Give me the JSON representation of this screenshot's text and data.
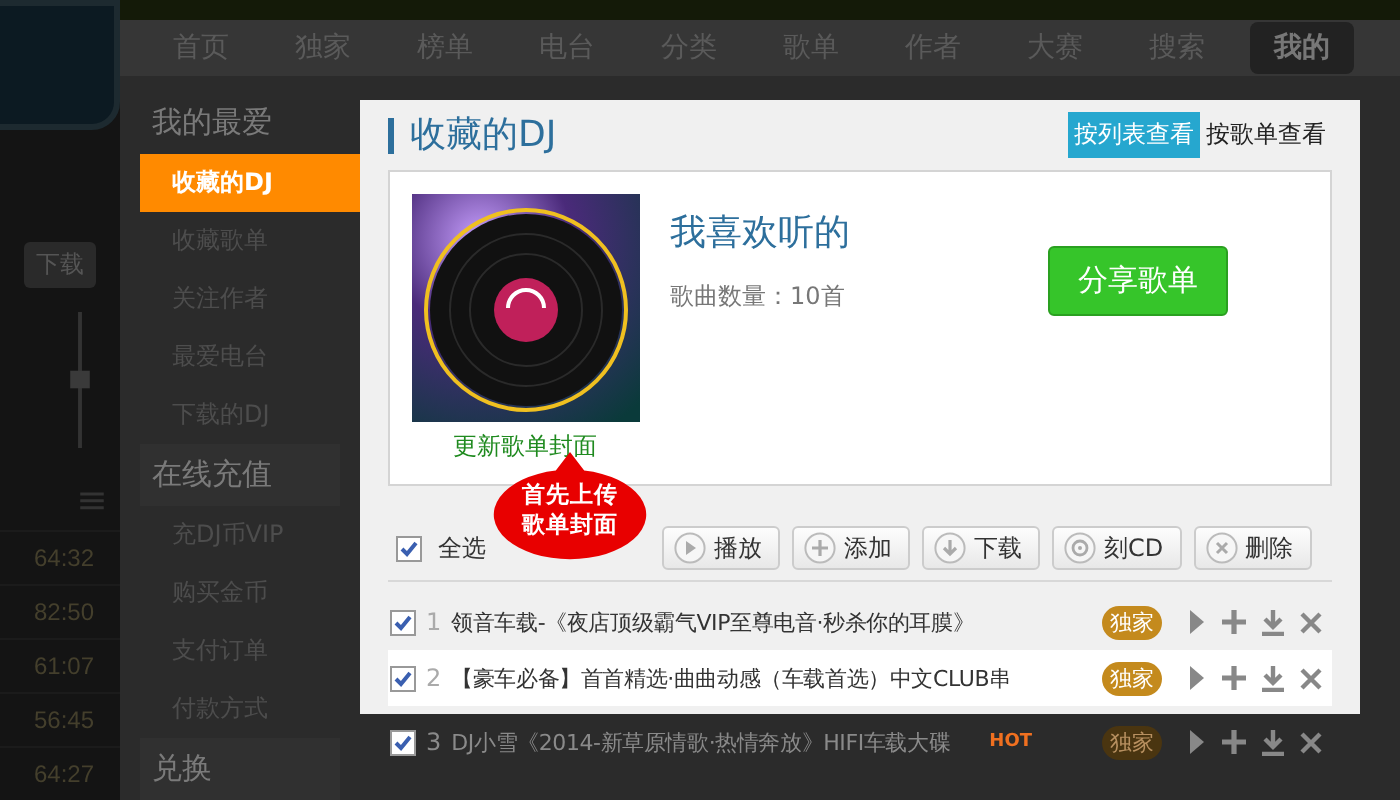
{
  "player": {
    "download": "下载",
    "times": [
      "64:32",
      "82:50",
      "61:07",
      "56:45",
      "64:27"
    ]
  },
  "nav": [
    {
      "label": "首页",
      "selected": false
    },
    {
      "label": "独家",
      "selected": false
    },
    {
      "label": "榜单",
      "selected": false
    },
    {
      "label": "电台",
      "selected": false
    },
    {
      "label": "分类",
      "selected": false
    },
    {
      "label": "歌单",
      "selected": false
    },
    {
      "label": "作者",
      "selected": false
    },
    {
      "label": "大赛",
      "selected": false
    },
    {
      "label": "搜索",
      "selected": false
    },
    {
      "label": "我的",
      "selected": true
    }
  ],
  "sidebar": [
    {
      "title": "我的最爱",
      "items": [
        {
          "label": "收藏的DJ",
          "selected": true
        },
        {
          "label": "收藏歌单",
          "selected": false
        },
        {
          "label": "关注作者",
          "selected": false
        },
        {
          "label": "最爱电台",
          "selected": false
        },
        {
          "label": "下载的DJ",
          "selected": false
        }
      ]
    },
    {
      "title": "在线充值",
      "items": [
        {
          "label": "充DJ币VIP",
          "selected": false
        },
        {
          "label": "购买金币",
          "selected": false
        },
        {
          "label": "支付订单",
          "selected": false
        },
        {
          "label": "付款方式",
          "selected": false
        }
      ]
    },
    {
      "title": "兑换"
    }
  ],
  "panel": {
    "title": "收藏的DJ",
    "view_tabs": [
      {
        "label": "按列表查看",
        "selected": true
      },
      {
        "label": "按歌单查看",
        "selected": false
      }
    ],
    "playlist": {
      "cover_link": "更新歌单封面",
      "name": "我喜欢听的",
      "count_label": "歌曲数量：",
      "count": "10首",
      "share": "分享歌单"
    },
    "callout": [
      "首先上传",
      "歌单封面"
    ],
    "select_all": {
      "label": "全选",
      "checked": true
    },
    "actions": [
      {
        "label": "播放",
        "kind": "play"
      },
      {
        "label": "添加",
        "kind": "add"
      },
      {
        "label": "下载",
        "kind": "download"
      },
      {
        "label": "刻CD",
        "kind": "disc"
      },
      {
        "label": "删除",
        "kind": "delete"
      }
    ],
    "tracks": [
      {
        "number": "1",
        "title": "领音车载-《夜店顶级霸气VIP至尊电音·秒杀你的耳膜》",
        "checked": true,
        "badge": "独家",
        "selected": false
      },
      {
        "number": "2",
        "title": "【豪车必备】首首精选·曲曲动感（车载首选）中文CLUB串",
        "checked": true,
        "badge": "独家",
        "selected": true
      }
    ]
  },
  "dimmed_tracks": [
    {
      "number": "3",
      "title": "DJ小雪《2014-新草原情歌·热情奔放》HIFI车载大碟",
      "hot": "HOT",
      "checked": true,
      "badge": "独家"
    }
  ]
}
